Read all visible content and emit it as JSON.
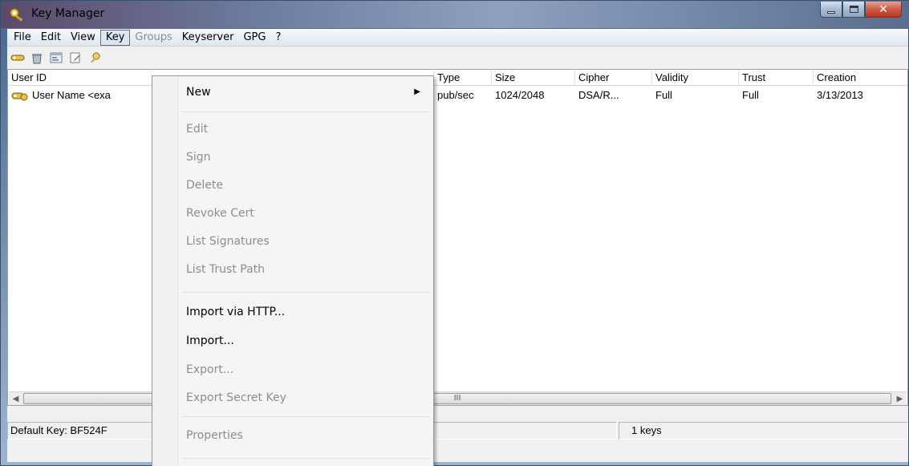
{
  "window": {
    "title": "Key Manager",
    "accent": "#6e7fa3",
    "close_color": "#c9452f"
  },
  "menubar": {
    "items": [
      {
        "label": "File",
        "disabled": false
      },
      {
        "label": "Edit",
        "disabled": false
      },
      {
        "label": "View",
        "disabled": false
      },
      {
        "label": "Key",
        "disabled": false,
        "active": true
      },
      {
        "label": "Groups",
        "disabled": true
      },
      {
        "label": "Keyserver",
        "disabled": false
      },
      {
        "label": "GPG",
        "disabled": false
      },
      {
        "label": "?",
        "disabled": false
      }
    ]
  },
  "toolbar": {
    "icons": [
      "key-pair-icon",
      "recycle-icon",
      "properties-icon",
      "edit-icon",
      "search-key-icon"
    ]
  },
  "listview": {
    "columns": [
      "User ID",
      "Type",
      "Size",
      "Cipher",
      "Validity",
      "Trust",
      "Creation"
    ],
    "rows": [
      {
        "user_id": "User Name <exa",
        "type": "pub/sec",
        "size": "1024/2048",
        "cipher": "DSA/R...",
        "validity": "Full",
        "trust": "Full",
        "creation": "3/13/2013"
      }
    ],
    "scroll_thumb_grip": "III"
  },
  "statusbar": {
    "default_key": "Default Key: BF524F",
    "key_count": "1 keys"
  },
  "key_menu": {
    "items": [
      {
        "label": "New",
        "disabled": false,
        "submenu": true
      },
      {
        "label": "Edit",
        "disabled": true
      },
      {
        "label": "Sign",
        "disabled": true
      },
      {
        "label": "Delete",
        "disabled": true
      },
      {
        "label": "Revoke Cert",
        "disabled": true
      },
      {
        "label": "List Signatures",
        "disabled": true
      },
      {
        "label": "List Trust Path",
        "disabled": true
      },
      {
        "label": "Import via HTTP...",
        "disabled": false
      },
      {
        "label": "Import...",
        "disabled": false
      },
      {
        "label": "Export...",
        "disabled": true
      },
      {
        "label": "Export Secret Key",
        "disabled": true
      },
      {
        "label": "Properties",
        "disabled": true
      }
    ],
    "submenu_arrow": "▶"
  }
}
